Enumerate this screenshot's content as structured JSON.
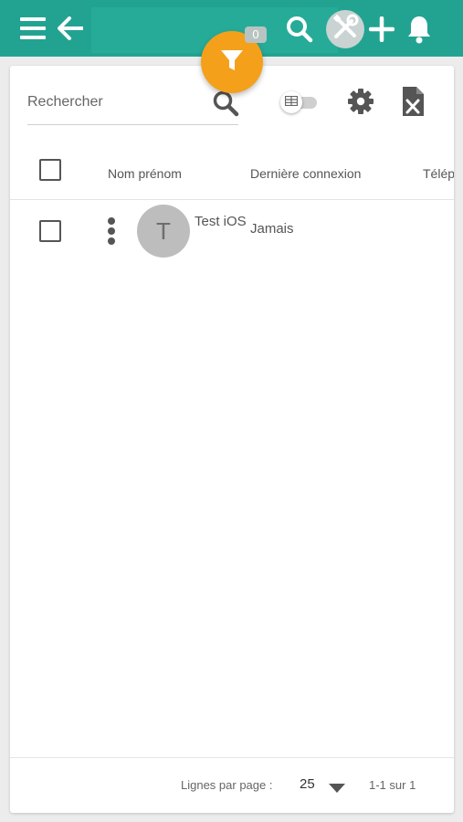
{
  "topbar": {
    "menu_icon": "hamburger-menu-icon",
    "back_icon": "arrow-left-icon",
    "search_icon": "search-icon",
    "tools_icon": "tools-wrench-screwdriver-icon",
    "add_icon": "plus-icon",
    "notifications_icon": "bell-icon",
    "color": "#22a392"
  },
  "filter": {
    "icon": "filter-funnel-icon",
    "badge_count": "0",
    "color": "#f5a01a"
  },
  "toolbar": {
    "search_placeholder": "Rechercher",
    "search_value": "",
    "view_toggle_icon": "table-icon",
    "settings_icon": "gear-icon",
    "export_icon": "excel-file-icon"
  },
  "table": {
    "columns": [
      "Nom prénom",
      "Dernière connexion",
      "Télép"
    ],
    "rows": [
      {
        "avatar_initial": "T",
        "name": "Test iOS",
        "last_login": "Jamais"
      }
    ]
  },
  "pagination": {
    "rows_per_page_label": "Lignes par page :",
    "rows_per_page_value": "25",
    "range_text": "1-1 sur 1"
  }
}
